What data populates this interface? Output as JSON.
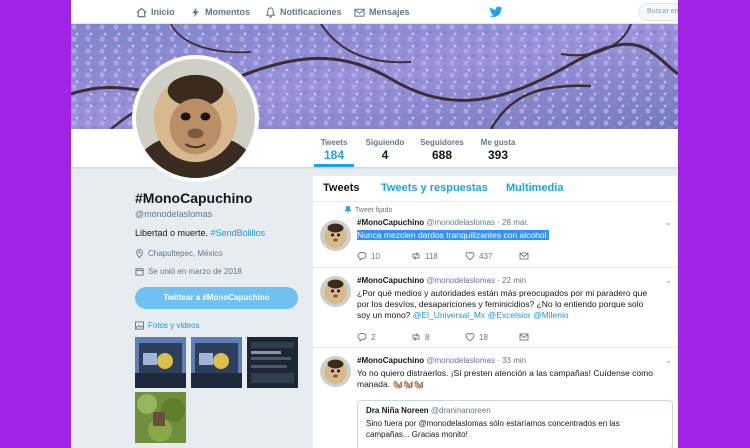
{
  "nav": {
    "home": "Inicio",
    "moments": "Momentos",
    "notifications": "Notificaciones",
    "messages": "Mensajes",
    "search_placeholder": "Buscar en"
  },
  "stats": [
    {
      "label": "Tweets",
      "value": "184"
    },
    {
      "label": "Siguiendo",
      "value": "4"
    },
    {
      "label": "Seguidores",
      "value": "688"
    },
    {
      "label": "Me gusta",
      "value": "393"
    }
  ],
  "profile": {
    "name": "#MonoCapuchino",
    "handle": "@monodelaslomas",
    "bio_text": "Libertad o muerte.",
    "bio_hashtag": "#SendBolillos",
    "location": "Chapultepec, México",
    "joined": "Se unió en marzo de 2018",
    "tweet_to_button": "Twittear a #MonoCapuchino",
    "media_label": "Fotos y videos"
  },
  "tabs": [
    "Tweets",
    "Tweets y respuestas",
    "Multimedia"
  ],
  "tweets": [
    {
      "pinned_label": "Tweet fijado",
      "name": "#MonoCapuchino",
      "handle": "@monodelaslomas",
      "time": "· 28 mar.",
      "text": "Nunca mezclen dardos tranquilizantes con alcohol.",
      "replies": "10",
      "retweets": "118",
      "likes": "437"
    },
    {
      "name": "#MonoCapuchino",
      "handle": "@monodelaslomas",
      "time": "· 22 min",
      "text": "¿Por qué medios y autoridades están más preocupados por mi paradero que por los desvíos, desapariciones y feminicidios? ¿No lo entiendo porque solo soy un mono?",
      "mention1": "@El_Universal_Mx",
      "mention2": "@Excelsior",
      "mention3": "@Milenio",
      "replies": "2",
      "retweets": "8",
      "likes": "18"
    },
    {
      "name": "#MonoCapuchino",
      "handle": "@monodelaslomas",
      "time": "· 33 min",
      "text": "Yo no quiero distraerlos. ¡Sí presten atención a las campañas! Cuídense como manada. 🐿️🐿️🐿️",
      "quote_name": "Dra Niña Noreen",
      "quote_handle": "@draninanoreen",
      "quote_text": "Sino fuera por @monodelaslomas sólo estaríamos concentrados en las campañas... Gracias monito!"
    }
  ],
  "colors": {
    "accent": "#1da1f2",
    "link": "#1b95e0",
    "background_frame": "#a023e6",
    "page_bg": "#e6ecf0"
  }
}
